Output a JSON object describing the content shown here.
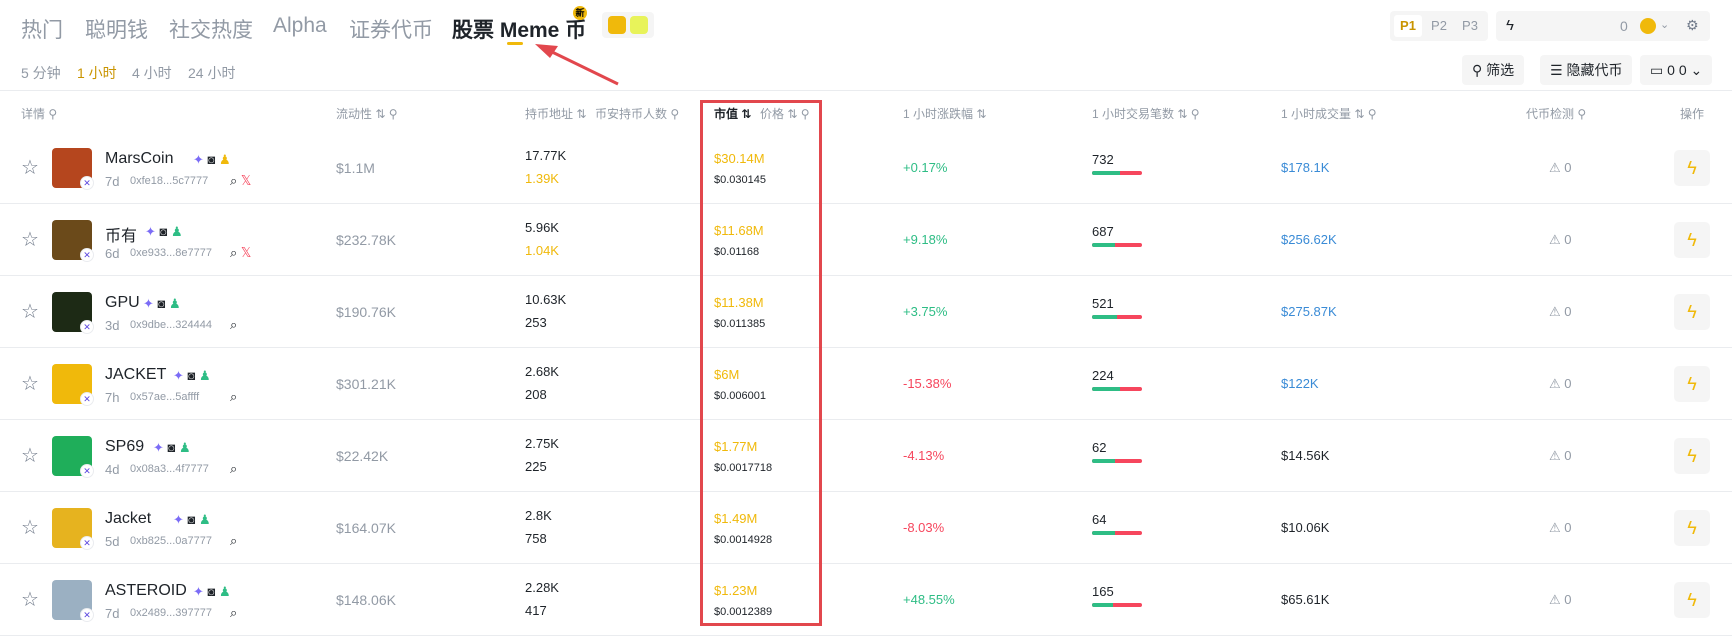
{
  "tabs": {
    "hot": "热门",
    "smart": "聪明钱",
    "social": "社交热度",
    "alpha": "Alpha",
    "stock_token": "证券代币",
    "stock_meme": "股票 Meme 币",
    "new_badge": "新"
  },
  "pages": [
    "P1",
    "P2",
    "P3"
  ],
  "quick_buy": {
    "amount": "0"
  },
  "timeframes": [
    "5 分钟",
    "1 小时",
    "4 小时",
    "24 小时"
  ],
  "actions": {
    "filter": "筛选",
    "hide_tokens": "隐藏代币",
    "count": "0",
    "count2": "0"
  },
  "columns": {
    "detail": "详情",
    "liquidity": "流动性",
    "holders": "持币地址",
    "bn_holders": "币安持币人数",
    "mcap": "市值",
    "price": "价格",
    "change": "1 小时涨跌幅",
    "txns": "1 小时交易笔数",
    "volume": "1 小时成交量",
    "check": "代币检测",
    "action": "操作"
  },
  "colors": {
    "accent": "#f0b90b",
    "up": "#2ebd85",
    "down": "#f6465d",
    "link": "#3a8bd6",
    "annotation": "#e2474d"
  },
  "rows": [
    {
      "name": "MarsCoin",
      "age": "7d",
      "addr": "0xfe18...5c7777",
      "liq": "$1.1M",
      "h1": "17.77K",
      "h2": "1.39K",
      "h2_highlight": true,
      "mc": "$30.14M",
      "price": "$0.030145",
      "chg": "+0.17%",
      "dir": "up",
      "txns": "732",
      "buy_ratio": 0.55,
      "vol": "$178.1K",
      "vol_highlight": true,
      "warn": "0",
      "avatar_color": "#b5461e"
    },
    {
      "name": "币有",
      "age": "6d",
      "addr": "0xe933...8e7777",
      "liq": "$232.78K",
      "h1": "5.96K",
      "h2": "1.04K",
      "h2_highlight": true,
      "mc": "$11.68M",
      "price": "$0.01168",
      "chg": "+9.18%",
      "dir": "up",
      "txns": "687",
      "buy_ratio": 0.45,
      "vol": "$256.62K",
      "vol_highlight": true,
      "warn": "0",
      "avatar_color": "#6b4a1a"
    },
    {
      "name": "GPU",
      "age": "3d",
      "addr": "0x9dbe...324444",
      "liq": "$190.76K",
      "h1": "10.63K",
      "h2": "253",
      "h2_highlight": false,
      "mc": "$11.38M",
      "price": "$0.011385",
      "chg": "+3.75%",
      "dir": "up",
      "txns": "521",
      "buy_ratio": 0.5,
      "vol": "$275.87K",
      "vol_highlight": true,
      "warn": "0",
      "avatar_color": "#1d2a15"
    },
    {
      "name": "JACKET",
      "age": "7h",
      "addr": "0x57ae...5affff",
      "liq": "$301.21K",
      "h1": "2.68K",
      "h2": "208",
      "h2_highlight": false,
      "mc": "$6M",
      "price": "$0.006001",
      "chg": "-15.38%",
      "dir": "down",
      "txns": "224",
      "buy_ratio": 0.55,
      "vol": "$122K",
      "vol_highlight": true,
      "warn": "0",
      "avatar_color": "#f0b90b"
    },
    {
      "name": "SP69",
      "age": "4d",
      "addr": "0x08a3...4f7777",
      "liq": "$22.42K",
      "h1": "2.75K",
      "h2": "225",
      "h2_highlight": false,
      "mc": "$1.77M",
      "price": "$0.0017718",
      "chg": "-4.13%",
      "dir": "down",
      "txns": "62",
      "buy_ratio": 0.45,
      "vol": "$14.56K",
      "vol_highlight": false,
      "warn": "0",
      "avatar_color": "#1fae5a"
    },
    {
      "name": "Jacket",
      "age": "5d",
      "addr": "0xb825...0a7777",
      "liq": "$164.07K",
      "h1": "2.8K",
      "h2": "758",
      "h2_highlight": false,
      "mc": "$1.49M",
      "price": "$0.0014928",
      "chg": "-8.03%",
      "dir": "down",
      "txns": "64",
      "buy_ratio": 0.45,
      "vol": "$10.06K",
      "vol_highlight": false,
      "warn": "0",
      "avatar_color": "#e6b31f"
    },
    {
      "name": "ASTEROID",
      "age": "7d",
      "addr": "0x2489...397777",
      "liq": "$148.06K",
      "h1": "2.28K",
      "h2": "417",
      "h2_highlight": false,
      "mc": "$1.23M",
      "price": "$0.0012389",
      "chg": "+48.55%",
      "dir": "up",
      "txns": "165",
      "buy_ratio": 0.42,
      "vol": "$65.61K",
      "vol_highlight": false,
      "warn": "0",
      "avatar_color": "#9bb0c2"
    }
  ]
}
